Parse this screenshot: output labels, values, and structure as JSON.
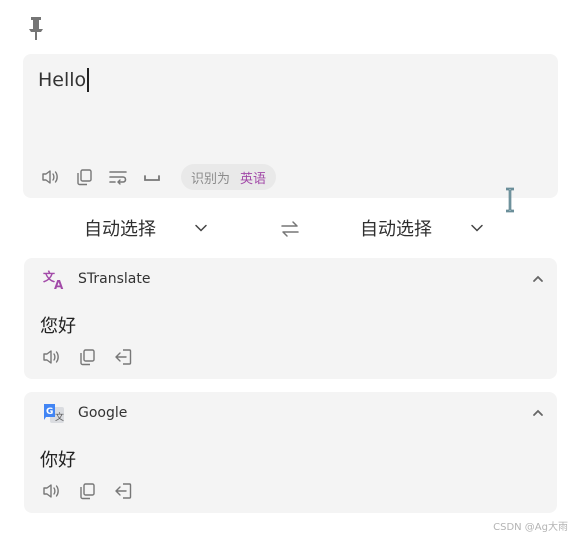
{
  "input": {
    "text": "Hello",
    "detect_label": "识别为",
    "detect_lang": "英语"
  },
  "languages": {
    "source": "自动选择",
    "target": "自动选择"
  },
  "results": [
    {
      "service": "STranslate",
      "text": "您好"
    },
    {
      "service": "Google",
      "text": "你好"
    }
  ],
  "icons": {
    "pin": "pin-icon",
    "speaker": "speaker-icon",
    "copy": "copy-icon",
    "wrap": "wrap-icon",
    "space": "space-icon",
    "swap": "swap-icon",
    "chevron": "chevron-down-icon",
    "collapse": "chevron-up-icon",
    "insert": "insert-icon"
  },
  "colors": {
    "accent": "#a24aa8",
    "panel": "#f4f4f4"
  },
  "watermark": "CSDN @Ag大雨"
}
